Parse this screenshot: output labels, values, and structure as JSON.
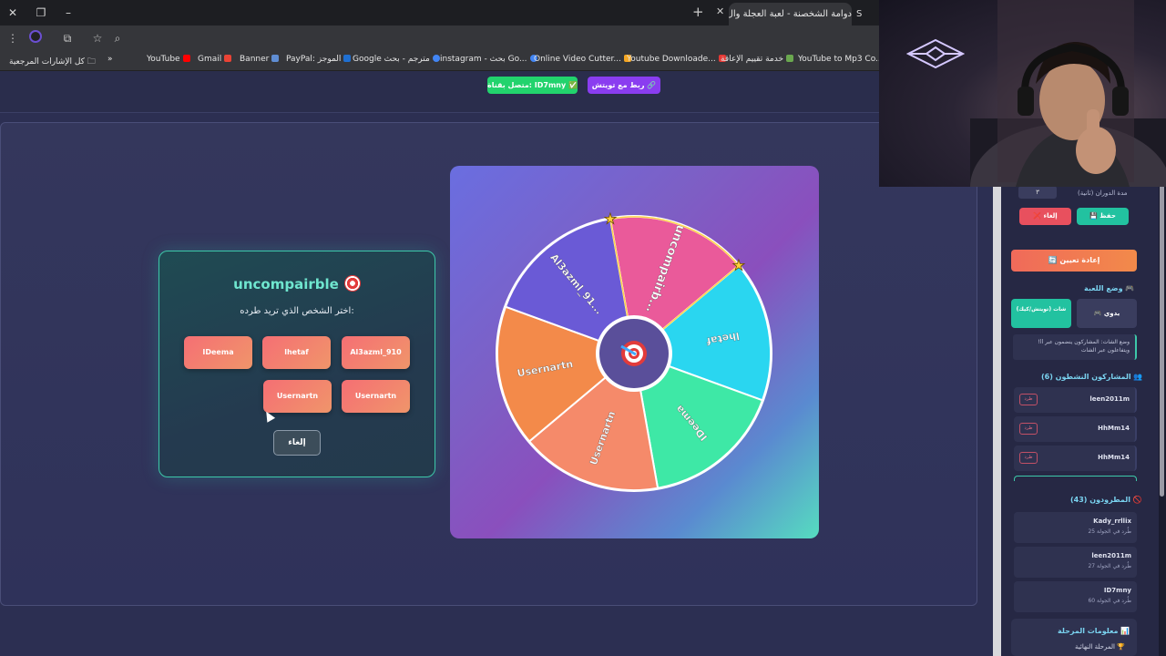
{
  "browser": {
    "active_tab_title": "دوامة الشخصنة - لعبة العجلة وال",
    "second_tab_title": "S",
    "bookmarks": [
      {
        "label": "كل الإشارات المرجعية",
        "color": "#999999"
      },
      {
        "label": "YouTube",
        "color": "#ff0000"
      },
      {
        "label": "Gmail",
        "color": "#ea4335"
      },
      {
        "label": "Banner",
        "color": "#5f8dd3"
      },
      {
        "label": "PayPal: الموجز",
        "color": "#1f6fd1"
      },
      {
        "label": "Google مترجم - بحث",
        "color": "#4285f4"
      },
      {
        "label": "instagram - بحث Go...",
        "color": "#4285f4"
      },
      {
        "label": "Online Video Cutter...",
        "color": "#f4a623"
      },
      {
        "label": "Youtube Downloade...",
        "color": "#e53935"
      },
      {
        "label": "خدمة تقييم الإعاقة",
        "color": "#6aa84f"
      },
      {
        "label": "YouTube to Mp3 Co...",
        "color": "#3366cc"
      }
    ],
    "overflow_label": "»"
  },
  "header": {
    "twitch_button": "ربط مع تويتش 🔗",
    "connected_button": "متصل بقناة: ID7mny ✅"
  },
  "elimination": {
    "title": "uncompairble",
    "subtitle": "اختر الشخص الذي تريد طرده:",
    "players_row1": [
      "Al3azml_910",
      "lhetaf",
      "IDeema"
    ],
    "players_row2": [
      "Usernartn",
      "Usernartn"
    ],
    "cancel": "إلغاء"
  },
  "wheel": {
    "segments": [
      {
        "label": "uncompairb...",
        "color": "#ea5a9a"
      },
      {
        "label": "lhetaf",
        "color": "#2ad6f0"
      },
      {
        "label": "IDeema",
        "color": "#3ee8a6"
      },
      {
        "label": "Usernartn",
        "color": "#f58a6a"
      },
      {
        "label": "Usernartn",
        "color": "#f38a4a"
      },
      {
        "label": "Al3azml_91...",
        "color": "#6a5ad6"
      }
    ],
    "center_icon": "target-icon"
  },
  "sidebar": {
    "spin_duration_label": "مدة الدوران (ثانية)",
    "spin_duration_value": "٣",
    "save": "حفظ",
    "cancel": "إلغاء",
    "reset": "إعادة تعيين",
    "game_mode_title": "وضع اللعبة",
    "mode_manual": "يدوي",
    "mode_chat": "شات (تويتش/كيك)",
    "mode_note": "وضع الشات: المشاركون ينضمون عبر ll! ويتفاعلون عبر الشات",
    "active_title": "المشاركون النشطون (6)",
    "kick_label": "طرد",
    "active_players": [
      "leen2011m",
      "HhMm14",
      "HhMm14"
    ],
    "eliminated_title": "المطرودون (43)",
    "eliminated": [
      {
        "name": "Kady_rrllix",
        "round": "طُرد في الجولة 25"
      },
      {
        "name": "leen2011m",
        "round": "طُرد في الجولة 27"
      },
      {
        "name": "ID7mny",
        "round": "طُرد في الجولة 60"
      }
    ],
    "stage_title": "معلومات المرحلة",
    "stage_sub": "المرحلة النهائية"
  }
}
